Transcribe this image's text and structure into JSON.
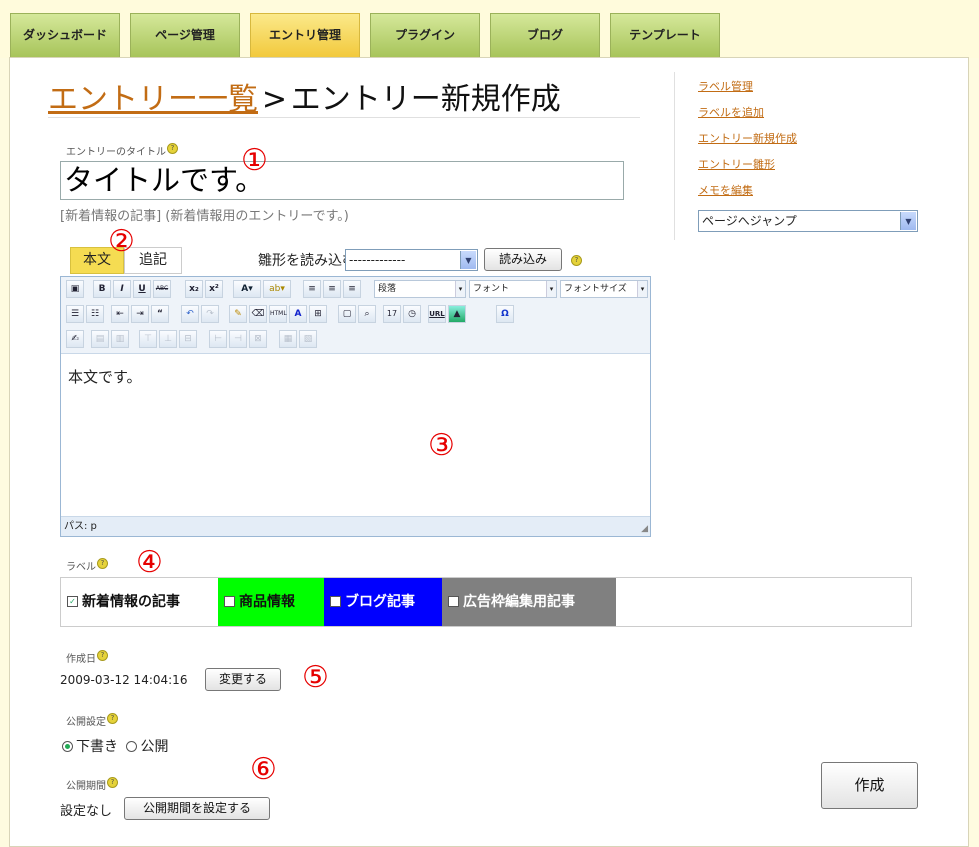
{
  "nav": {
    "tabs": [
      {
        "label": "ダッシュボード",
        "active": false
      },
      {
        "label": "ページ管理",
        "active": false
      },
      {
        "label": "エントリ管理",
        "active": true
      },
      {
        "label": "プラグイン",
        "active": false
      },
      {
        "label": "ブログ",
        "active": false
      },
      {
        "label": "テンプレート",
        "active": false
      }
    ]
  },
  "header": {
    "breadcrumb_link": "エントリー一覧",
    "separator": ">",
    "current": "エントリー新規作成"
  },
  "title_field": {
    "label": "エントリーのタイトル",
    "value": "タイトルです。",
    "note": "[新着情報の記事] (新着情報用のエントリーです。)"
  },
  "body_tabs": {
    "main": "本文",
    "more": "追記"
  },
  "template_loader": {
    "label": "雛形を読み込む",
    "selected": "-------------",
    "button": "読み込み"
  },
  "editor": {
    "format_select": "段落",
    "font_select": "フォント",
    "size_select": "フォントサイズ",
    "content": "本文です。",
    "path": "パス: p"
  },
  "labels": {
    "heading": "ラベル",
    "items": [
      {
        "text": "新着情報の記事",
        "checked": true,
        "bg": "#ffffff",
        "fg": "#111111"
      },
      {
        "text": "商品情報",
        "checked": false,
        "bg": "#00ff00",
        "fg": "#111111"
      },
      {
        "text": "ブログ記事",
        "checked": false,
        "bg": "#0000ff",
        "fg": "#ffffff"
      },
      {
        "text": "広告枠編集用記事",
        "checked": false,
        "bg": "#808080",
        "fg": "#ffffff"
      }
    ]
  },
  "created": {
    "heading": "作成日",
    "value": "2009-03-12 14:04:16",
    "button": "変更する"
  },
  "publish": {
    "heading": "公開設定",
    "draft": "下書き",
    "public": "公開",
    "selected": "draft"
  },
  "period": {
    "heading": "公開期間",
    "value": "設定なし",
    "button": "公開期間を設定する"
  },
  "submit_label": "作成",
  "sidebar": {
    "links": [
      "ラベル管理",
      "ラベルを追加",
      "エントリー新規作成",
      "エントリー雛形",
      "メモを編集"
    ],
    "jump_select": "ページへジャンプ"
  },
  "annotations": [
    "①",
    "②",
    "③",
    "④",
    "⑤",
    "⑥"
  ]
}
